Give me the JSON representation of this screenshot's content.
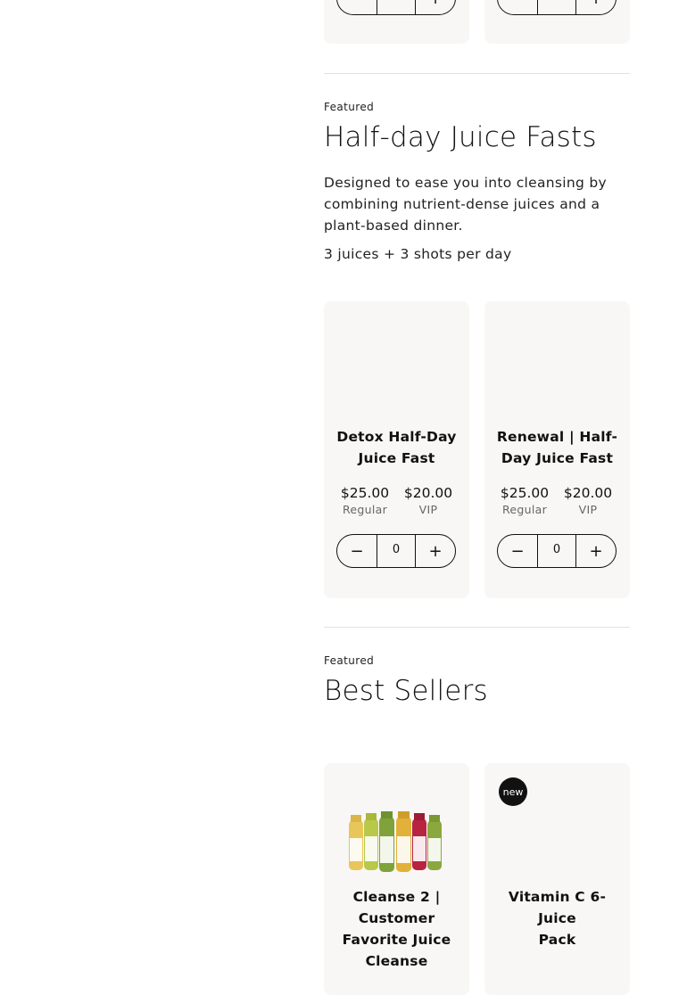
{
  "top_cards": [
    {
      "qty": ""
    },
    {
      "qty": ""
    }
  ],
  "sections": {
    "half_day": {
      "eyebrow": "Featured",
      "title": "Half-day Juice Fasts",
      "description": "Designed to ease you into cleansing by combining nutrient-dense juices and a plant-based dinner.",
      "subline": "3 juices + 3 shots per day",
      "products": [
        {
          "name_line1": "Detox Half-Day",
          "name_line2": "Juice Fast",
          "regular_price": "$25.00",
          "regular_label": "Regular",
          "vip_price": "$20.00",
          "vip_label": "VIP",
          "qty": "0"
        },
        {
          "name_line1": "Renewal | Half-",
          "name_line2": "Day Juice Fast",
          "regular_price": "$25.00",
          "regular_label": "Regular",
          "vip_price": "$20.00",
          "vip_label": "VIP",
          "qty": "0"
        }
      ]
    },
    "best_sellers": {
      "eyebrow": "Featured",
      "title": "Best Sellers",
      "products": [
        {
          "name_lines": [
            "Cleanse 2 |",
            "Customer",
            "Favorite Juice",
            "Cleanse"
          ],
          "image_icon": "juice-bottles-image"
        },
        {
          "badge": "new",
          "name_lines": [
            "Vitamin C 6-Juice",
            "Pack"
          ]
        }
      ]
    }
  },
  "stepper_icons": {
    "decrement": "minus-icon",
    "increment": "plus-icon"
  },
  "colors": {
    "card_bg": "#f8f7f5",
    "text": "#111111",
    "muted": "#666666",
    "divider": "#e2e2e2",
    "badge_bg": "#111111"
  }
}
